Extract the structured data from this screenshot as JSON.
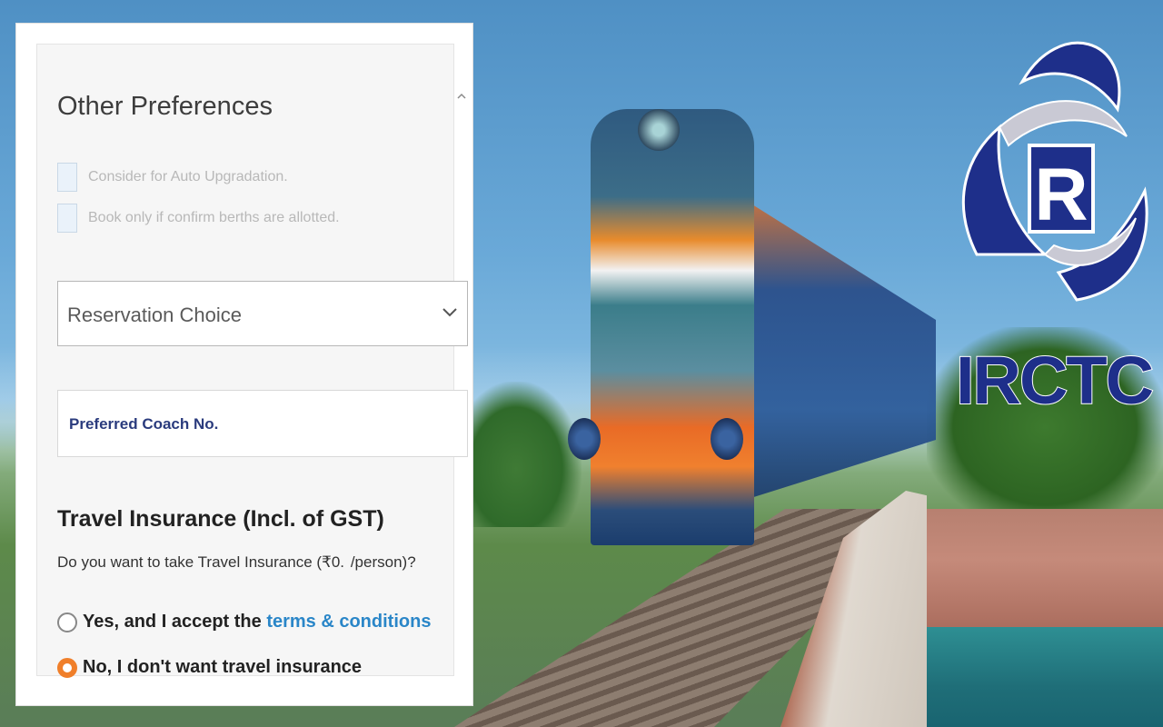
{
  "panel": {
    "title": "Other Preferences",
    "checkboxes": [
      {
        "label": "Consider for Auto Upgradation.",
        "checked": false
      },
      {
        "label": "Book only if confirm berths are allotted.",
        "checked": false
      }
    ],
    "reservation_choice": {
      "value": "Reservation Choice"
    },
    "preferred_coach": {
      "placeholder": "Preferred Coach No."
    },
    "insurance": {
      "title": "Travel Insurance (Incl. of GST)",
      "question": "Do you want to take Travel Insurance (₹0.  /person)?",
      "options": [
        {
          "text_prefix": "Yes, and I accept the ",
          "link_text": "terms & conditions",
          "selected": false
        },
        {
          "text_prefix": "No, I don't want travel insurance",
          "link_text": "",
          "selected": true
        }
      ]
    }
  },
  "logo": {
    "text": "IRCTC",
    "color": "#1e2f8a"
  },
  "colors": {
    "accent": "#f07f2a",
    "link": "#2a86c8"
  },
  "icons": {
    "collapse": "chevron-up-icon",
    "dropdown": "chevron-down-icon"
  }
}
